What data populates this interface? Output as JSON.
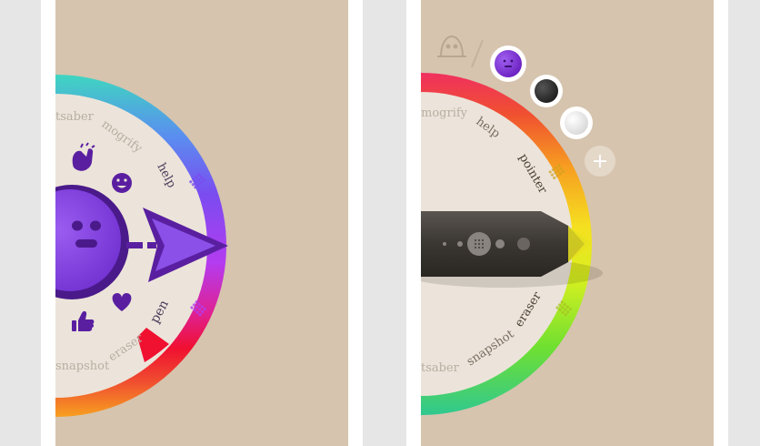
{
  "left_screen": {
    "wheel_labels": {
      "mogrify": "mogrify",
      "help": "help",
      "pen": "pen",
      "eraser": "eraser",
      "snapshot": "snapshot",
      "tsaber": "tsaber"
    },
    "icons": [
      "clapping-hands-icon",
      "smiley-icon",
      "heart-icon",
      "thumbs-up-icon",
      "purple-face-icon",
      "arrow-pointer-icon",
      "grid-handle-icon"
    ]
  },
  "right_screen": {
    "wheel_labels": {
      "mogrify": "mogrify",
      "help": "help",
      "pointer": "pointer",
      "eraser": "eraser",
      "snapshot": "snapshot",
      "tsaber": "tsaber"
    },
    "color_swatches": [
      {
        "name": "purple",
        "color": "#7b2fd0"
      },
      {
        "name": "black",
        "color": "#2a2a2a"
      },
      {
        "name": "white",
        "color": "#f4f4f4"
      }
    ],
    "add_button_label": "+",
    "icons": [
      "ghost-icon",
      "pen-tool-icon",
      "grid-handle-icon",
      "plus-icon"
    ]
  }
}
